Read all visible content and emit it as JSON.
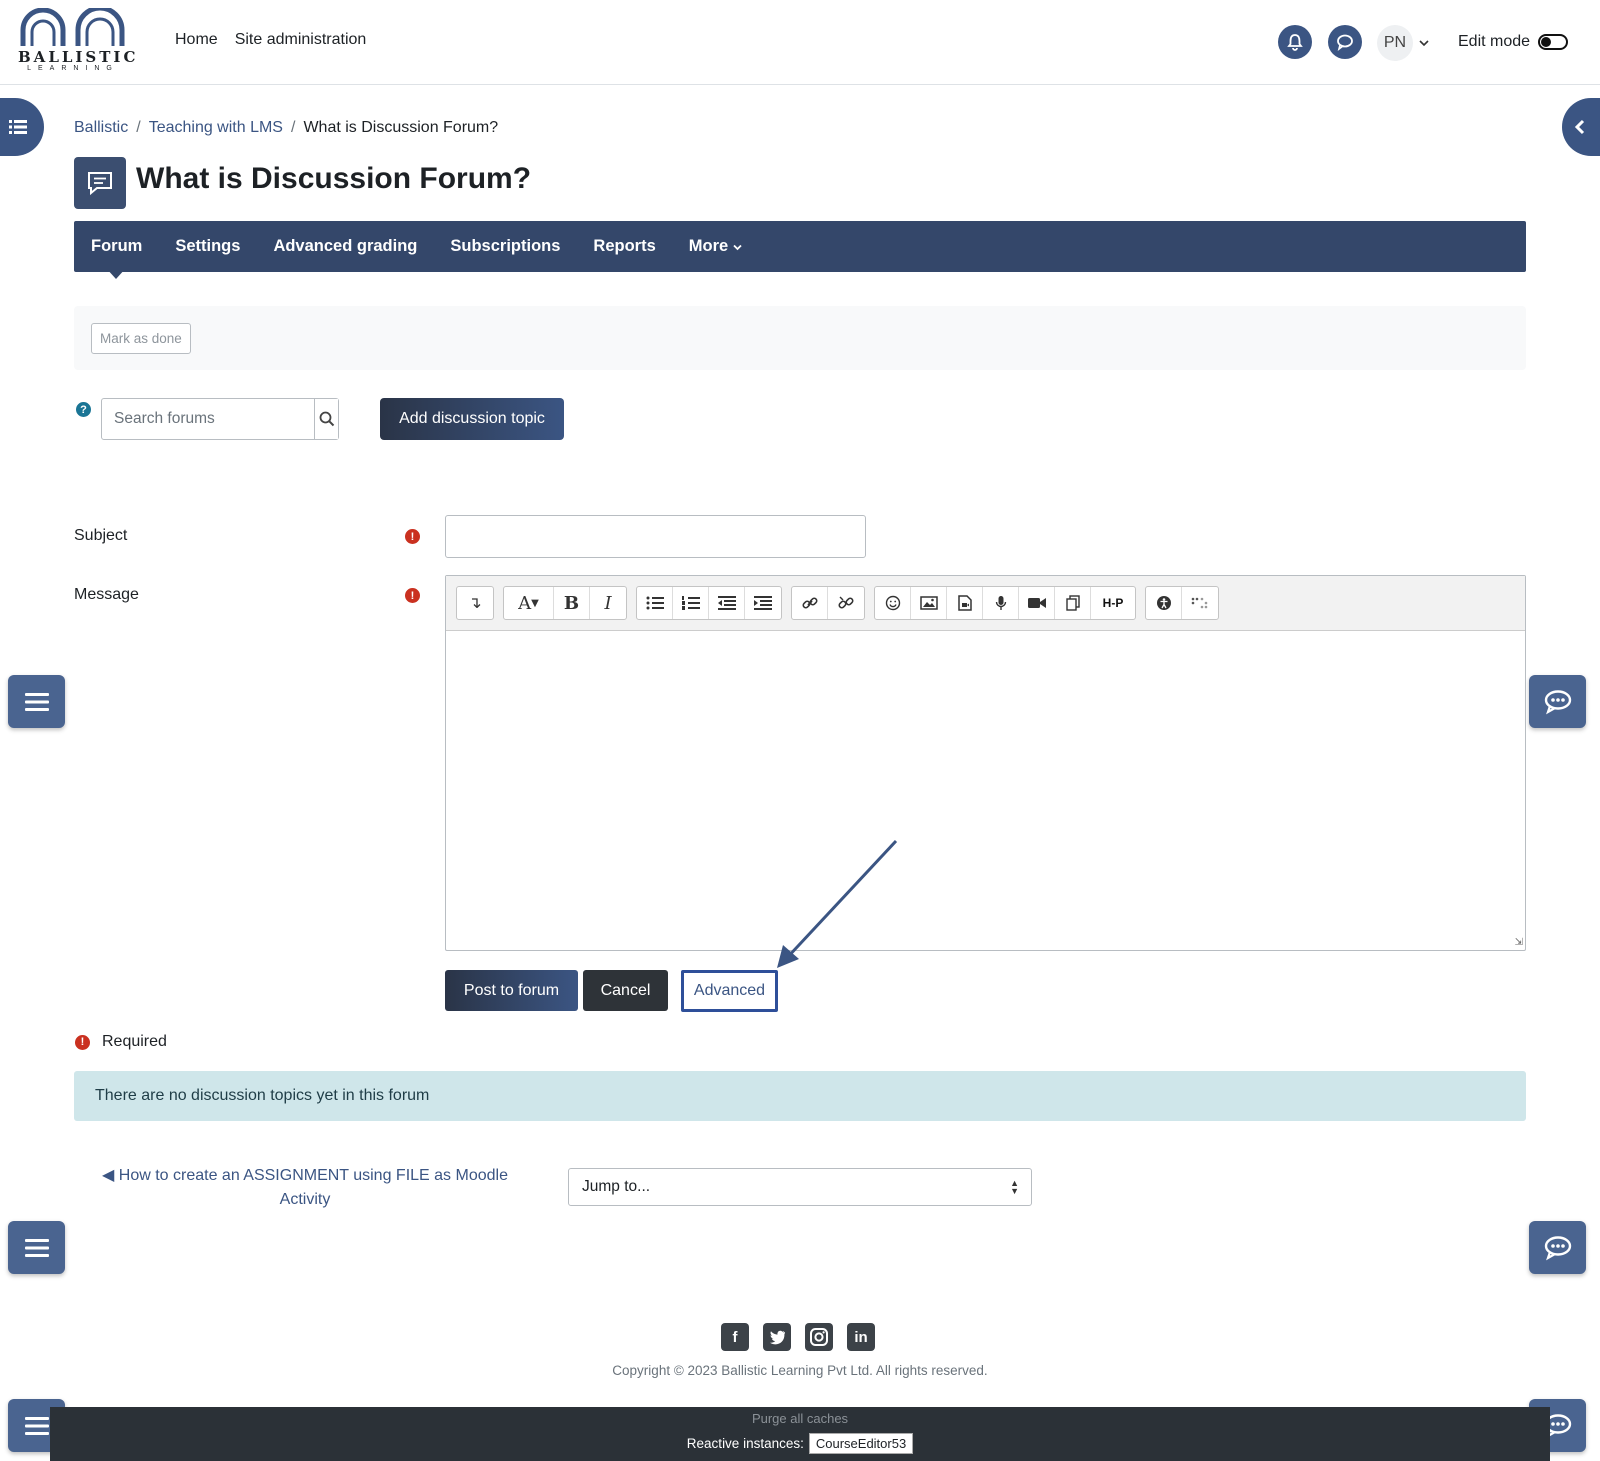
{
  "brand": {
    "name": "BALLISTIC",
    "sub": "LEARNING"
  },
  "primary_nav": {
    "home": "Home",
    "site_admin": "Site administration"
  },
  "user": {
    "initials": "PN",
    "edit_mode_label": "Edit mode"
  },
  "breadcrumb": {
    "items": [
      "Ballistic",
      "Teaching with LMS"
    ],
    "current": "What is Discussion Forum?",
    "separator": "/"
  },
  "page": {
    "title": "What is Discussion Forum?"
  },
  "secondary_nav": {
    "tabs": [
      "Forum",
      "Settings",
      "Advanced grading",
      "Subscriptions",
      "Reports"
    ],
    "more": "More"
  },
  "activity": {
    "mark_done": "Mark as done"
  },
  "search": {
    "placeholder": "Search forums",
    "help": "?"
  },
  "add_topic": "Add discussion topic",
  "form": {
    "subject_label": "Subject",
    "message_label": "Message",
    "required_icon": "!",
    "subject_value": "",
    "post_button": "Post to forum",
    "cancel_button": "Cancel",
    "advanced_button": "Advanced",
    "required_note": "Required"
  },
  "editor_toolbar": {
    "icons": [
      "collapse-icon",
      "font-size-icon",
      "bold-icon",
      "italic-icon",
      "unordered-list-icon",
      "ordered-list-icon",
      "outdent-icon",
      "indent-icon",
      "link-icon",
      "unlink-icon",
      "emoji-icon",
      "image-icon",
      "media-icon",
      "record-audio-icon",
      "record-video-icon",
      "manage-files-icon",
      "h5p-icon",
      "accessibility-checker-icon",
      "screenreader-helper-icon"
    ],
    "bold": "B",
    "italic": "I",
    "font": "A",
    "collapse": "↴",
    "h5p": "H-P"
  },
  "alert": {
    "text": "There are no discussion topics yet in this forum"
  },
  "activity_nav": {
    "prev_link": "◀ How to create an ASSIGNMENT using FILE as Moodle Activity",
    "jump_to": "Jump to..."
  },
  "footer": {
    "social": [
      "f",
      "t",
      "ig",
      "in"
    ],
    "copyright": "Copyright © 2023 Ballistic Learning Pvt Ltd. All rights reserved.",
    "purge": "Purge all caches",
    "reactive_label": "Reactive instances:",
    "reactive_value": "CourseEditor53"
  },
  "colors": {
    "primary": "#3b5583",
    "nav_bg": "#34476a",
    "required": "#ca3120",
    "alert_bg": "#cfe6ea",
    "arrow": "#3b5583"
  }
}
